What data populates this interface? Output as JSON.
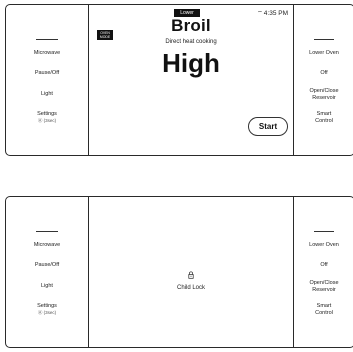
{
  "left_controls": {
    "microwave": "Microwave",
    "pause_off": "Pause/Off",
    "light": "Light",
    "settings": "Settings",
    "settings_sub": "Ⓐ (3sec)"
  },
  "right_controls": {
    "lower_oven": "Lower Oven",
    "off": "Off",
    "open_close": "Open/Close",
    "reservoir": "Reservoir",
    "smart": "Smart",
    "control": "Control"
  },
  "display": {
    "oven_mode_badge_line1": "OVEN",
    "oven_mode_badge_line2": "MODE",
    "lower_badge": "Lower",
    "time": "4:35 PM",
    "mode_title": "Broil",
    "mode_subtitle": "Direct heat cooking",
    "level": "High",
    "start_label": "Start"
  },
  "locked_display": {
    "child_lock_label": "Child Lock"
  },
  "icons": {
    "wifi": "wifi-icon",
    "lock": "lock-icon"
  }
}
